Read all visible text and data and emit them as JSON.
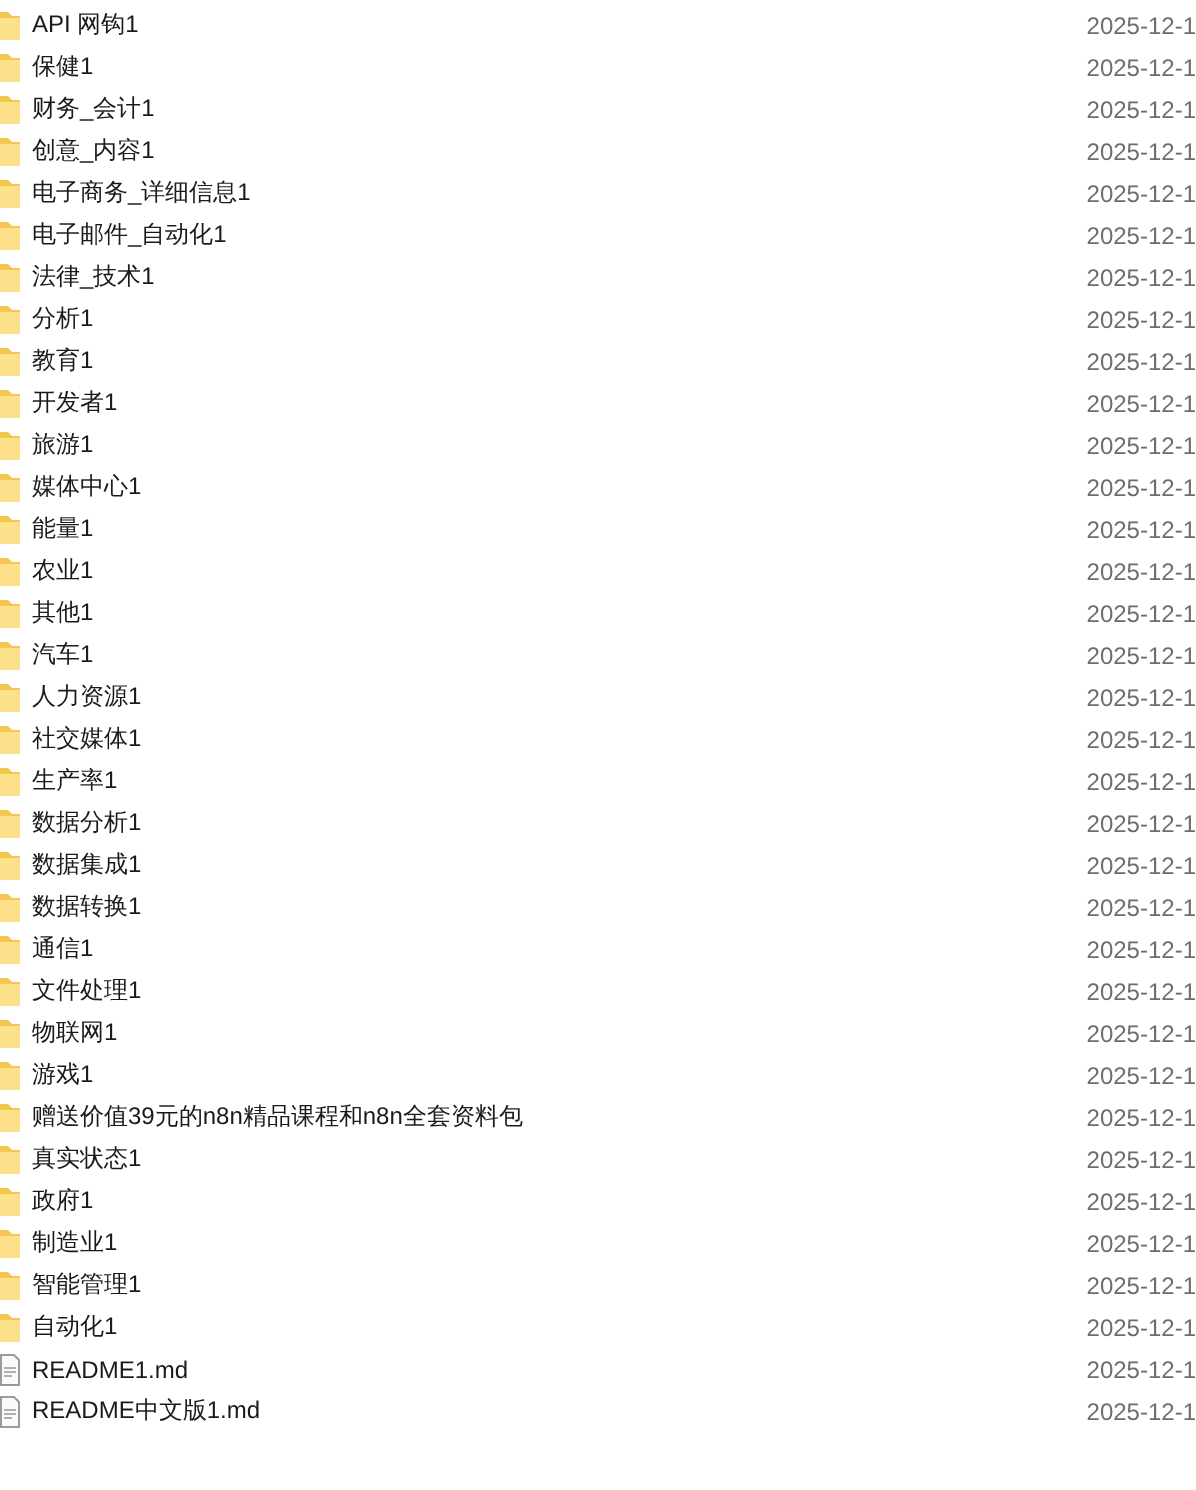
{
  "files": [
    {
      "kind": "folder",
      "name": "API 网钩1",
      "date": "2025-12-1"
    },
    {
      "kind": "folder",
      "name": "保健1",
      "date": "2025-12-1"
    },
    {
      "kind": "folder",
      "name": "财务_会计1",
      "date": "2025-12-1"
    },
    {
      "kind": "folder",
      "name": "创意_内容1",
      "date": "2025-12-1"
    },
    {
      "kind": "folder",
      "name": "电子商务_详细信息1",
      "date": "2025-12-1"
    },
    {
      "kind": "folder",
      "name": "电子邮件_自动化1",
      "date": "2025-12-1"
    },
    {
      "kind": "folder",
      "name": "法律_技术1",
      "date": "2025-12-1"
    },
    {
      "kind": "folder",
      "name": "分析1",
      "date": "2025-12-1"
    },
    {
      "kind": "folder",
      "name": "教育1",
      "date": "2025-12-1"
    },
    {
      "kind": "folder",
      "name": "开发者1",
      "date": "2025-12-1"
    },
    {
      "kind": "folder",
      "name": "旅游1",
      "date": "2025-12-1"
    },
    {
      "kind": "folder",
      "name": "媒体中心1",
      "date": "2025-12-1"
    },
    {
      "kind": "folder",
      "name": "能量1",
      "date": "2025-12-1"
    },
    {
      "kind": "folder",
      "name": "农业1",
      "date": "2025-12-1"
    },
    {
      "kind": "folder",
      "name": "其他1",
      "date": "2025-12-1"
    },
    {
      "kind": "folder",
      "name": "汽车1",
      "date": "2025-12-1"
    },
    {
      "kind": "folder",
      "name": "人力资源1",
      "date": "2025-12-1"
    },
    {
      "kind": "folder",
      "name": "社交媒体1",
      "date": "2025-12-1"
    },
    {
      "kind": "folder",
      "name": "生产率1",
      "date": "2025-12-1"
    },
    {
      "kind": "folder",
      "name": "数据分析1",
      "date": "2025-12-1"
    },
    {
      "kind": "folder",
      "name": "数据集成1",
      "date": "2025-12-1"
    },
    {
      "kind": "folder",
      "name": "数据转换1",
      "date": "2025-12-1"
    },
    {
      "kind": "folder",
      "name": "通信1",
      "date": "2025-12-1"
    },
    {
      "kind": "folder",
      "name": "文件处理1",
      "date": "2025-12-1"
    },
    {
      "kind": "folder",
      "name": "物联网1",
      "date": "2025-12-1"
    },
    {
      "kind": "folder",
      "name": "游戏1",
      "date": "2025-12-1"
    },
    {
      "kind": "folder",
      "name": "赠送价值39元的n8n精品课程和n8n全套资料包",
      "date": "2025-12-1"
    },
    {
      "kind": "folder",
      "name": "真实状态1",
      "date": "2025-12-1"
    },
    {
      "kind": "folder",
      "name": "政府1",
      "date": "2025-12-1"
    },
    {
      "kind": "folder",
      "name": "制造业1",
      "date": "2025-12-1"
    },
    {
      "kind": "folder",
      "name": "智能管理1",
      "date": "2025-12-1"
    },
    {
      "kind": "folder",
      "name": "自动化1",
      "date": "2025-12-1"
    },
    {
      "kind": "file",
      "name": "README1.md",
      "date": "2025-12-1"
    },
    {
      "kind": "file",
      "name": "README中文版1.md",
      "date": "2025-12-1"
    }
  ]
}
